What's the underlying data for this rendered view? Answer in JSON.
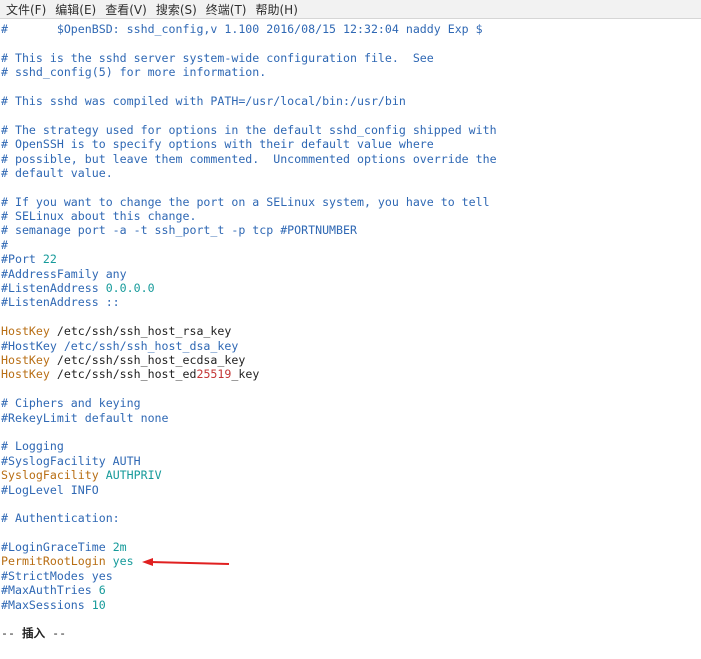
{
  "menu": [
    "文件(F)",
    "编辑(E)",
    "查看(V)",
    "搜索(S)",
    "终端(T)",
    "帮助(H)"
  ],
  "lines": [
    [
      {
        "t": "#       $OpenBSD: sshd_config,v 1.100 2016/08/15 12:32:04 naddy Exp $",
        "c": "c"
      }
    ],
    [],
    [
      {
        "t": "# This is the sshd server system-wide configuration file.  See",
        "c": "c"
      }
    ],
    [
      {
        "t": "# sshd_config(5) for more information.",
        "c": "c"
      }
    ],
    [],
    [
      {
        "t": "# This sshd was compiled with PATH=/usr/local/bin:/usr/bin",
        "c": "c"
      }
    ],
    [],
    [
      {
        "t": "# The strategy used for options in the default sshd_config shipped with",
        "c": "c"
      }
    ],
    [
      {
        "t": "# OpenSSH is to specify options with their default value where",
        "c": "c"
      }
    ],
    [
      {
        "t": "# possible, but leave them commented.  Uncommented options override the",
        "c": "c"
      }
    ],
    [
      {
        "t": "# default value.",
        "c": "c"
      }
    ],
    [],
    [
      {
        "t": "# If you want to change the port on a SELinux system, you have to tell",
        "c": "c"
      }
    ],
    [
      {
        "t": "# SELinux about this change.",
        "c": "c"
      }
    ],
    [
      {
        "t": "# semanage port -a -t ssh_port_t -p tcp #PORTNUMBER",
        "c": "c"
      }
    ],
    [
      {
        "t": "#",
        "c": "c"
      }
    ],
    [
      {
        "t": "#Port ",
        "c": "c"
      },
      {
        "t": "22",
        "c": "v"
      }
    ],
    [
      {
        "t": "#AddressFamily any",
        "c": "c"
      }
    ],
    [
      {
        "t": "#ListenAddress ",
        "c": "c"
      },
      {
        "t": "0.0.0.0",
        "c": "v"
      }
    ],
    [
      {
        "t": "#ListenAddress ::",
        "c": "c"
      }
    ],
    [],
    [
      {
        "t": "HostKey",
        "c": "k"
      },
      {
        "t": " /etc/ssh/ssh_host_rsa_key",
        "c": "t"
      }
    ],
    [
      {
        "t": "#HostKey /etc/ssh/ssh_host_dsa_key",
        "c": "c"
      }
    ],
    [
      {
        "t": "HostKey",
        "c": "k"
      },
      {
        "t": " /etc/ssh/ssh_host_ecdsa_key",
        "c": "t"
      }
    ],
    [
      {
        "t": "HostKey",
        "c": "k"
      },
      {
        "t": " /etc/ssh/ssh_host_ed",
        "c": "t"
      },
      {
        "t": "25519",
        "c": "n"
      },
      {
        "t": "_key",
        "c": "t"
      }
    ],
    [],
    [
      {
        "t": "# Ciphers and keying",
        "c": "c"
      }
    ],
    [
      {
        "t": "#RekeyLimit default none",
        "c": "c"
      }
    ],
    [],
    [
      {
        "t": "# Logging",
        "c": "c"
      }
    ],
    [
      {
        "t": "#SyslogFacility AUTH",
        "c": "c"
      }
    ],
    [
      {
        "t": "SyslogFacility",
        "c": "k"
      },
      {
        "t": " AUTHPRIV",
        "c": "v"
      }
    ],
    [
      {
        "t": "#LogLevel INFO",
        "c": "c"
      }
    ],
    [],
    [
      {
        "t": "# Authentication:",
        "c": "c"
      }
    ],
    [],
    [
      {
        "t": "#LoginGraceTime ",
        "c": "c"
      },
      {
        "t": "2m",
        "c": "v"
      }
    ],
    [
      {
        "t": "PermitRootLogin",
        "c": "k"
      },
      {
        "t": " yes",
        "c": "v"
      }
    ],
    [
      {
        "t": "#StrictModes yes",
        "c": "c"
      }
    ],
    [
      {
        "t": "#MaxAuthTries ",
        "c": "c"
      },
      {
        "t": "6",
        "c": "v"
      }
    ],
    [
      {
        "t": "#MaxSessions ",
        "c": "c"
      },
      {
        "t": "10",
        "c": "v"
      }
    ],
    [],
    [
      {
        "t": "-- ",
        "c": "t"
      },
      {
        "t": "插入",
        "c": "mode"
      },
      {
        "t": " --",
        "c": "t"
      }
    ]
  ],
  "colors": {
    "comment": "#2f68b4",
    "directive": "#b86e14",
    "value": "#159a9a",
    "number": "#c33535",
    "annotation_arrow": "#e02020"
  },
  "annotation": {
    "icon": "arrow-left-icon",
    "target_line_index": 37
  }
}
